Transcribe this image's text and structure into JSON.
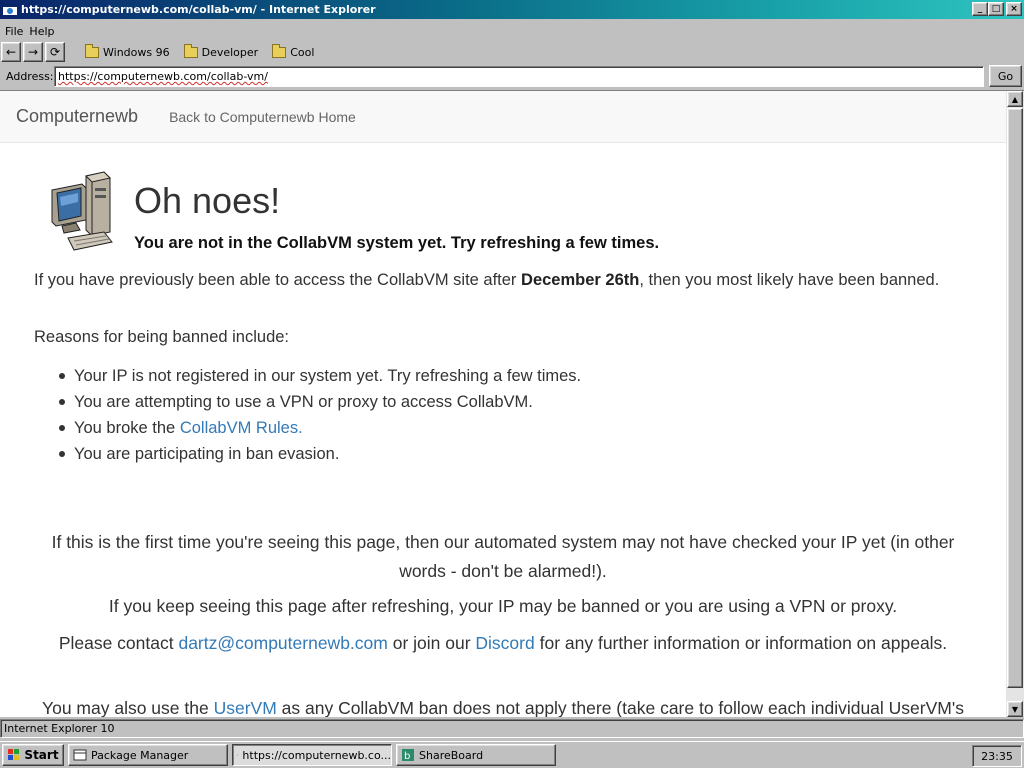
{
  "window": {
    "title": "https://computernewb.com/collab-vm/ - Internet Explorer",
    "controls": {
      "minimize": "_",
      "maximize": "□",
      "close": "×"
    }
  },
  "menu": {
    "items": [
      "File",
      "Help"
    ]
  },
  "toolbar": {
    "back": "←",
    "forward": "→",
    "refresh": "⟳",
    "favorites": [
      "Windows 96",
      "Developer",
      "Cool"
    ]
  },
  "address": {
    "label": "Address:",
    "url": "https://computernewb.com/collab-vm/",
    "go_label": "Go"
  },
  "page": {
    "nav": {
      "brand": "Computernewb",
      "link": "Back to Computernewb Home"
    },
    "heading": "Oh noes!",
    "subheading": "You are not in the CollabVM system yet. Try refreshing a few times.",
    "p1": {
      "before": "If you have previously been able to access the CollabVM site after ",
      "bold": "December 26th",
      "after": ", then you most likely have been banned."
    },
    "reasons_intro": "Reasons for being banned include:",
    "reasons": {
      "r1": "Your IP is not registered in our system yet. Try refreshing a few times.",
      "r2": "You are attempting to use a VPN or proxy to access CollabVM.",
      "r3_before": "You broke the ",
      "r3_link": "CollabVM Rules.",
      "r4": "You are participating in ban evasion."
    },
    "first_time": "If this is the first time you're seeing this page, then our automated system may not have checked your IP yet (in other words - don't be alarmed!).",
    "keep_seeing": "If you keep seeing this page after refreshing, your IP may be banned or you are using a VPN or proxy.",
    "contact": {
      "before": "Please contact ",
      "email": "dartz@computernewb.com",
      "middle": " or join our ",
      "discord": "Discord",
      "after": " for any further information or information on appeals."
    },
    "uservm": {
      "before": "You may also use the ",
      "link": "UserVM",
      "after": " as any CollabVM ban does not apply there (take care to follow each individual UserVM's rules.)."
    }
  },
  "status": {
    "text": "Internet Explorer 10"
  },
  "taskbar": {
    "start_label": "Start",
    "tasks": [
      {
        "label": "Package Manager"
      },
      {
        "label": "https://computernewb.co..."
      },
      {
        "label": "ShareBoard"
      }
    ],
    "clock": "23:35"
  },
  "colors": {
    "link": "#337ab7",
    "titlebar_start": "#0a246a",
    "titlebar_end": "#2ec4c0"
  }
}
